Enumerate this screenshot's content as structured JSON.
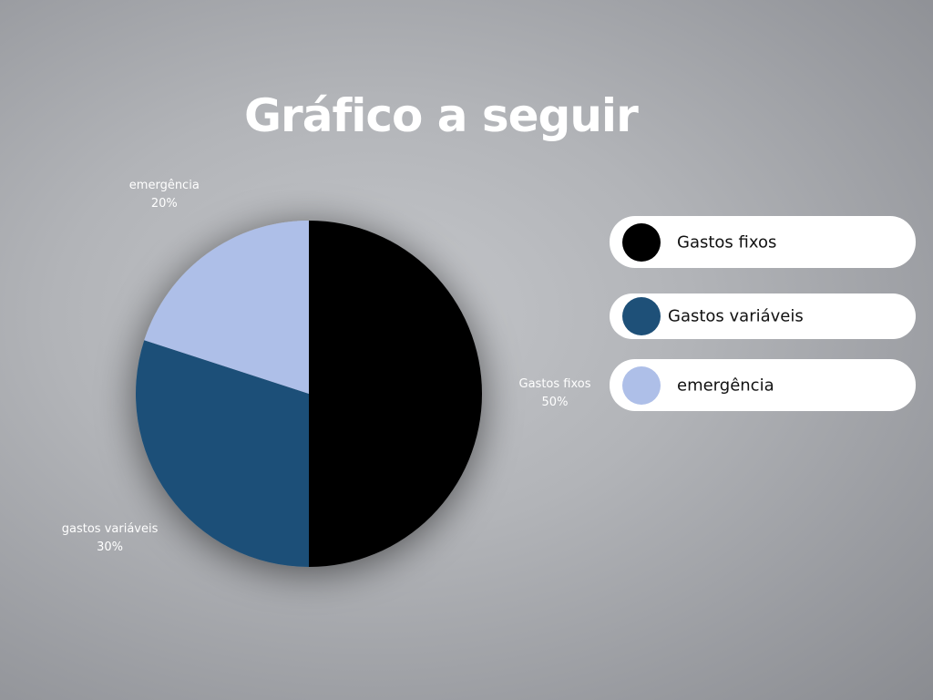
{
  "page": {
    "title": "Gráfico a seguir",
    "background_color": "#b8babe"
  },
  "chart_data": {
    "type": "pie",
    "title": "Gráfico a seguir",
    "slices": [
      {
        "label": "Gastos fixos",
        "value": 50,
        "percent_label": "50%",
        "color": "#000000"
      },
      {
        "label": "gastos variáveis",
        "value": 30,
        "percent_label": "30%",
        "color": "#1e5078"
      },
      {
        "label": "emergência",
        "value": 20,
        "percent_label": "20%",
        "color": "#aebfe8"
      }
    ],
    "start_angle_deg": 0,
    "direction": "clockwise",
    "legend_placement": "right"
  },
  "legend": {
    "items": [
      {
        "label": "Gastos fixos",
        "color": "#000000"
      },
      {
        "label": "Gastos variáveis",
        "color": "#1e5078"
      },
      {
        "label": "emergência",
        "color": "#aebfe8"
      }
    ]
  }
}
